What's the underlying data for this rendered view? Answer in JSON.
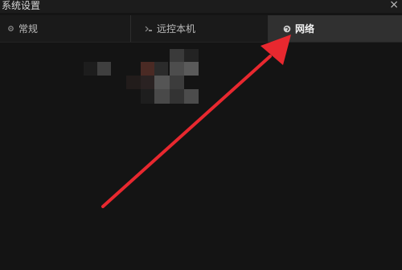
{
  "window": {
    "title": "系统设置",
    "close_glyph": "×"
  },
  "tabs": [
    {
      "label": "常规",
      "icon": "gear-icon",
      "active": false
    },
    {
      "label": "远控本机",
      "icon": "remote-control-icon",
      "active": false
    },
    {
      "label": "网络",
      "icon": "network-globe-icon",
      "active": true
    }
  ],
  "annotation": {
    "type": "arrow",
    "color": "#e8282f",
    "target": "tab-network"
  },
  "colors": {
    "background": "#141414",
    "tab_bar": "#1a1a1a",
    "active_tab": "#303030",
    "arrow": "#e8282f"
  }
}
